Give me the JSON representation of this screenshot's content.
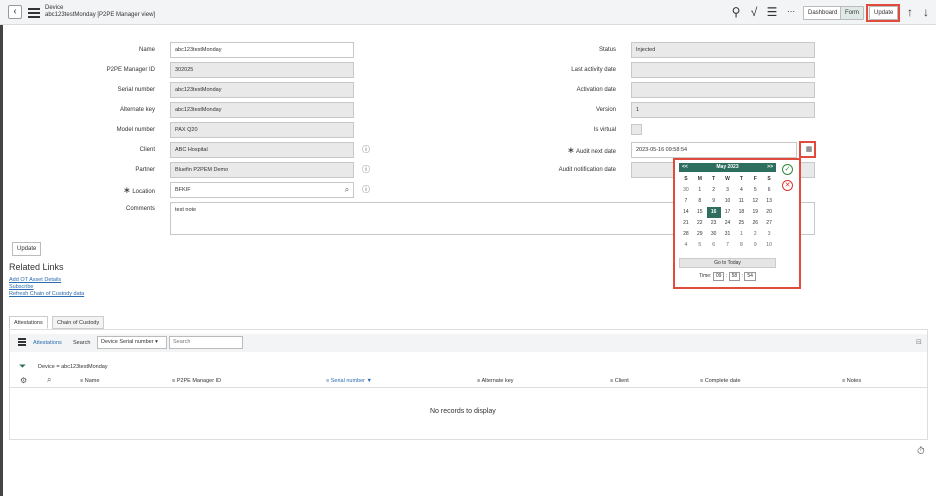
{
  "header": {
    "title_line1": "Device",
    "title_line2": "abc123testMonday [P2PE Manager view]",
    "buttons": {
      "dashboard": "Dashboard",
      "form": "Form",
      "update": "Update"
    },
    "icons": [
      "back-icon",
      "hamburger-icon",
      "attachment-icon",
      "activity-icon",
      "settings-icon",
      "more-icon",
      "up-arrow-icon",
      "down-arrow-icon"
    ]
  },
  "form_left": [
    {
      "label": "Name",
      "value": "abc123testMonday"
    },
    {
      "label": "P2PE Manager ID",
      "value": "302025"
    },
    {
      "label": "Serial number",
      "value": "abc123testMonday"
    },
    {
      "label": "Alternate key",
      "value": "abc123testMonday"
    },
    {
      "label": "Model number",
      "value": "PAX Q20"
    },
    {
      "label": "Client",
      "value": "ABC Hospital"
    },
    {
      "label": "Partner",
      "value": "Bluefin P2PEM Demo"
    },
    {
      "label": "Location",
      "value": "BFKIF"
    },
    {
      "label": "Comments",
      "value": "test note"
    }
  ],
  "form_right": [
    {
      "label": "Status",
      "value": "Injected"
    },
    {
      "label": "Last activity date",
      "value": ""
    },
    {
      "label": "Activation date",
      "value": ""
    },
    {
      "label": "Version",
      "value": "1"
    },
    {
      "label": "Is virtual",
      "value": ""
    },
    {
      "label": "Audit next date",
      "value": "2023-05-16 09:58:54"
    },
    {
      "label": "Audit notification date",
      "value": ""
    }
  ],
  "calendar": {
    "prev": "<<",
    "month": "May 2023",
    "next": ">>",
    "weekdays": [
      "S",
      "M",
      "T",
      "W",
      "T",
      "F",
      "S"
    ],
    "weeks": [
      [
        "30",
        "1",
        "2",
        "3",
        "4",
        "5",
        "6"
      ],
      [
        "7",
        "8",
        "9",
        "10",
        "11",
        "12",
        "13"
      ],
      [
        "14",
        "15",
        "16",
        "17",
        "18",
        "19",
        "20"
      ],
      [
        "21",
        "22",
        "23",
        "24",
        "25",
        "26",
        "27"
      ],
      [
        "28",
        "29",
        "30",
        "31",
        "1",
        "2",
        "3"
      ],
      [
        "4",
        "5",
        "6",
        "7",
        "8",
        "9",
        "10"
      ]
    ],
    "selected": "16",
    "go_to_today": "Go to Today",
    "time_label": "Time:",
    "time_h": "09",
    "time_m": "58",
    "time_s": "54"
  },
  "update_button": "Update",
  "related_links": {
    "title": "Related Links",
    "links": [
      "Add OT Asset Details",
      "Subscribe",
      "Refresh Chain of Custody data"
    ]
  },
  "tabs": [
    "Attestations",
    "Chain of Custody"
  ],
  "list": {
    "name": "Attestations",
    "search_label": "Search",
    "filter_field": "Device Serial number",
    "search_placeholder": "Search",
    "filter_text": "Device = abc123testMonday",
    "columns": [
      "Name",
      "P2PE Manager ID",
      "Serial number",
      "Alternate key",
      "Client",
      "Complete date",
      "Notes"
    ],
    "empty": "No records to display"
  }
}
